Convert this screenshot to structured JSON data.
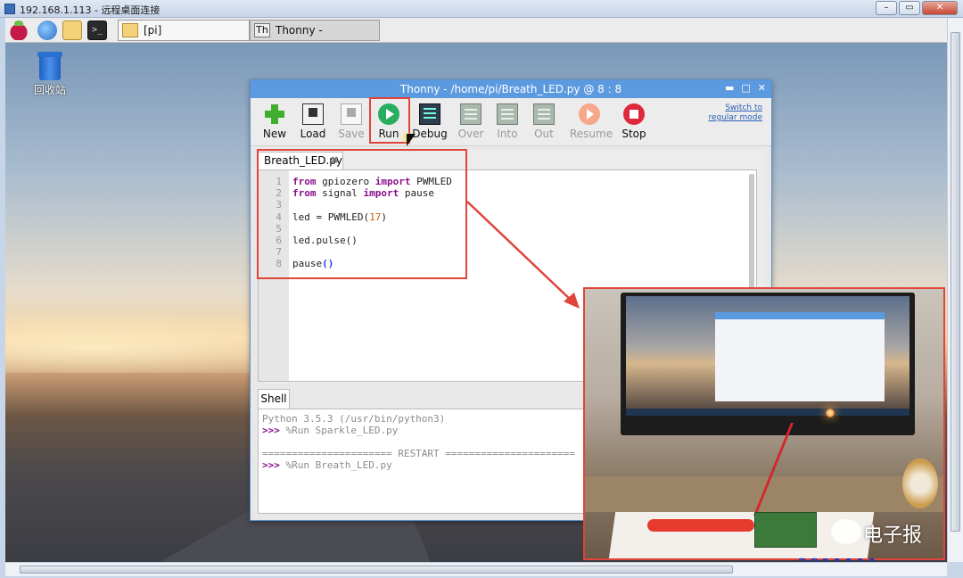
{
  "remote_window": {
    "title": "192.168.1.113 - 远程桌面连接",
    "min": "–",
    "max": "▭",
    "close": "✕"
  },
  "panel": {
    "terminal_glyph": ">_",
    "tasks": [
      {
        "label": "[pi]"
      },
      {
        "label": "Thonny  -  /home/pi/..."
      }
    ],
    "thonny_glyph": "Th"
  },
  "desktop": {
    "trash_label": "回收站"
  },
  "thonny": {
    "title": "Thonny  -  /home/pi/Breath_LED.py  @  8 : 8",
    "ctrl_min": "▬",
    "ctrl_max": "□",
    "ctrl_close": "✕",
    "switch_mode": [
      "Switch to",
      "regular mode"
    ],
    "toolbar": [
      {
        "label": "New",
        "icon": "plus-icon",
        "enabled": true
      },
      {
        "label": "Load",
        "icon": "load-icon",
        "enabled": true
      },
      {
        "label": "Save",
        "icon": "save-icon",
        "enabled": false
      },
      {
        "label": "Run",
        "icon": "play-icon",
        "enabled": true
      },
      {
        "label": "Debug",
        "icon": "debug-icon",
        "enabled": true
      },
      {
        "label": "Over",
        "icon": "step-over-icon",
        "enabled": false
      },
      {
        "label": "Into",
        "icon": "step-into-icon",
        "enabled": false
      },
      {
        "label": "Out",
        "icon": "step-out-icon",
        "enabled": false
      },
      {
        "label": "Resume",
        "icon": "resume-icon",
        "enabled": false
      },
      {
        "label": "Stop",
        "icon": "stop-icon",
        "enabled": true
      }
    ],
    "editor": {
      "tab_label": "Breath_LED.py",
      "tab_close": "✖",
      "lines": [
        {
          "n": "1",
          "parts": [
            [
              "kw",
              "from"
            ],
            [
              "",
              " gpiozero "
            ],
            [
              "kw",
              "import"
            ],
            [
              "",
              " PWMLED"
            ]
          ]
        },
        {
          "n": "2",
          "parts": [
            [
              "kw",
              "from"
            ],
            [
              "",
              " signal "
            ],
            [
              "kw",
              "import"
            ],
            [
              "",
              " pause"
            ]
          ]
        },
        {
          "n": "3",
          "parts": []
        },
        {
          "n": "4",
          "parts": [
            [
              "",
              "led = PWMLED("
            ],
            [
              "num",
              "17"
            ],
            [
              "",
              ")"
            ]
          ]
        },
        {
          "n": "5",
          "parts": []
        },
        {
          "n": "6",
          "parts": [
            [
              "",
              "led.pulse()"
            ]
          ]
        },
        {
          "n": "7",
          "parts": []
        },
        {
          "n": "8",
          "parts": [
            [
              "",
              "pause"
            ],
            [
              "paren",
              "()"
            ]
          ]
        }
      ]
    },
    "shell": {
      "tab_label": "Shell",
      "lines": [
        {
          "prompt": "",
          "text": "Python 3.5.3 (/usr/bin/python3)"
        },
        {
          "prompt": ">>> ",
          "text": "%Run Sparkle_LED.py"
        },
        {
          "prompt": "",
          "text": ""
        },
        {
          "prompt": "",
          "text": "====================== RESTART ======================"
        },
        {
          "prompt": ">>> ",
          "text": "%Run Breath_LED.py"
        }
      ]
    }
  },
  "watermark": {
    "brand": "电子报",
    "site": "www.3811111.com"
  },
  "colors": {
    "annotation_red": "#e0443a",
    "thonny_title": "#5c9ae0",
    "keyword": "#8a0f8a"
  }
}
